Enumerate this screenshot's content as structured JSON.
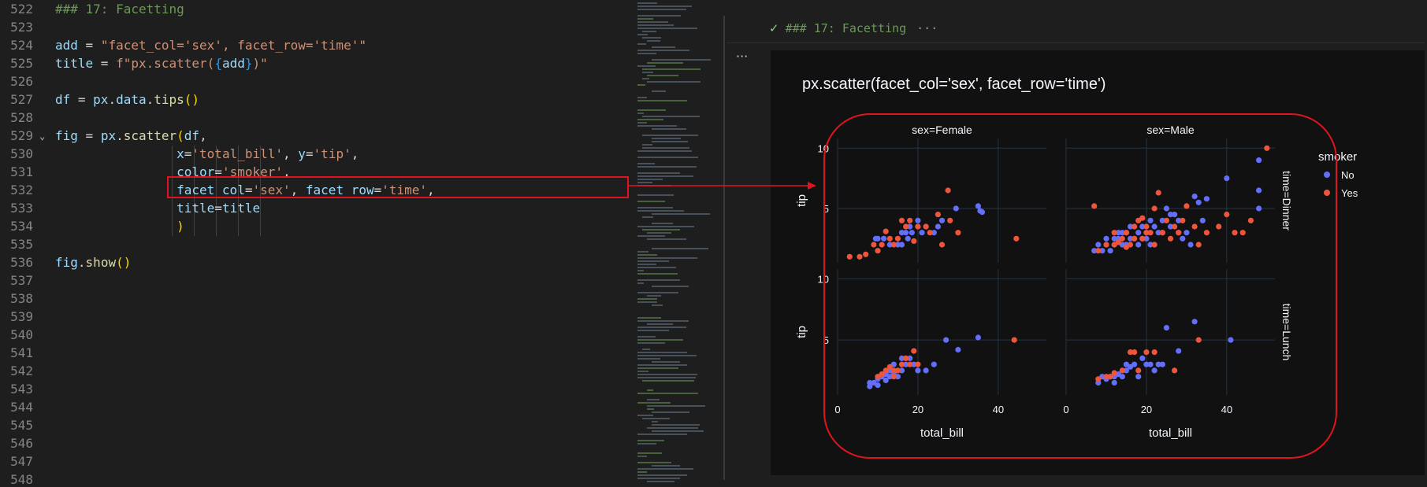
{
  "editor": {
    "lines": [
      {
        "n": "522",
        "tokens": [
          {
            "t": "### 17: Facetting",
            "c": "c-com"
          }
        ]
      },
      {
        "n": "523",
        "tokens": []
      },
      {
        "n": "524",
        "tokens": [
          {
            "t": "add",
            "c": "c-var"
          },
          {
            "t": " = ",
            "c": "c-op"
          },
          {
            "t": "\"facet_col='sex', facet_row='time'\"",
            "c": "c-str"
          }
        ]
      },
      {
        "n": "525",
        "tokens": [
          {
            "t": "title",
            "c": "c-var"
          },
          {
            "t": " = ",
            "c": "c-op"
          },
          {
            "t": "f\"px.scatter(",
            "c": "c-str"
          },
          {
            "t": "{",
            "c": "c-br3"
          },
          {
            "t": "add",
            "c": "c-var"
          },
          {
            "t": "}",
            "c": "c-br3"
          },
          {
            "t": ")\"",
            "c": "c-str"
          }
        ]
      },
      {
        "n": "526",
        "tokens": []
      },
      {
        "n": "527",
        "tokens": [
          {
            "t": "df",
            "c": "c-var"
          },
          {
            "t": " = ",
            "c": "c-op"
          },
          {
            "t": "px",
            "c": "c-var"
          },
          {
            "t": ".",
            "c": "c-op"
          },
          {
            "t": "data",
            "c": "c-var"
          },
          {
            "t": ".",
            "c": "c-op"
          },
          {
            "t": "tips",
            "c": "c-fn"
          },
          {
            "t": "()",
            "c": "c-br"
          }
        ]
      },
      {
        "n": "528",
        "tokens": []
      },
      {
        "n": "529",
        "fold": true,
        "tokens": [
          {
            "t": "fig",
            "c": "c-var"
          },
          {
            "t": " = ",
            "c": "c-op"
          },
          {
            "t": "px",
            "c": "c-var"
          },
          {
            "t": ".",
            "c": "c-op"
          },
          {
            "t": "scatter",
            "c": "c-fn"
          },
          {
            "t": "(",
            "c": "c-br"
          },
          {
            "t": "df",
            "c": "c-var"
          },
          {
            "t": ",",
            "c": "c-op"
          }
        ]
      },
      {
        "n": "530",
        "tokens": [
          {
            "t": "                ",
            "c": "c-op"
          },
          {
            "t": "x",
            "c": "c-var"
          },
          {
            "t": "=",
            "c": "c-op"
          },
          {
            "t": "'total_bill'",
            "c": "c-str"
          },
          {
            "t": ", ",
            "c": "c-op"
          },
          {
            "t": "y",
            "c": "c-var"
          },
          {
            "t": "=",
            "c": "c-op"
          },
          {
            "t": "'tip'",
            "c": "c-str"
          },
          {
            "t": ",",
            "c": "c-op"
          }
        ]
      },
      {
        "n": "531",
        "tokens": [
          {
            "t": "                ",
            "c": "c-op"
          },
          {
            "t": "color",
            "c": "c-var"
          },
          {
            "t": "=",
            "c": "c-op"
          },
          {
            "t": "'smoker'",
            "c": "c-str"
          },
          {
            "t": ",",
            "c": "c-op"
          }
        ]
      },
      {
        "n": "532",
        "tokens": [
          {
            "t": "                ",
            "c": "c-op"
          },
          {
            "t": "facet_col",
            "c": "c-var"
          },
          {
            "t": "=",
            "c": "c-op"
          },
          {
            "t": "'sex'",
            "c": "c-str"
          },
          {
            "t": ", ",
            "c": "c-op"
          },
          {
            "t": "facet_row",
            "c": "c-var"
          },
          {
            "t": "=",
            "c": "c-op"
          },
          {
            "t": "'time'",
            "c": "c-str"
          },
          {
            "t": ",",
            "c": "c-op"
          }
        ]
      },
      {
        "n": "533",
        "tokens": [
          {
            "t": "                ",
            "c": "c-op"
          },
          {
            "t": "title",
            "c": "c-var"
          },
          {
            "t": "=",
            "c": "c-op"
          },
          {
            "t": "title",
            "c": "c-var"
          }
        ]
      },
      {
        "n": "534",
        "tokens": [
          {
            "t": "                ",
            "c": "c-op"
          },
          {
            "t": ")",
            "c": "c-br"
          }
        ]
      },
      {
        "n": "535",
        "tokens": []
      },
      {
        "n": "536",
        "tokens": [
          {
            "t": "fig",
            "c": "c-var"
          },
          {
            "t": ".",
            "c": "c-op"
          },
          {
            "t": "show",
            "c": "c-fn"
          },
          {
            "t": "()",
            "c": "c-br"
          }
        ]
      },
      {
        "n": "537",
        "tokens": []
      },
      {
        "n": "538",
        "tokens": []
      },
      {
        "n": "539",
        "tokens": []
      },
      {
        "n": "540",
        "tokens": []
      },
      {
        "n": "541",
        "tokens": []
      },
      {
        "n": "542",
        "tokens": []
      },
      {
        "n": "543",
        "tokens": []
      },
      {
        "n": "544",
        "tokens": []
      },
      {
        "n": "545",
        "tokens": []
      },
      {
        "n": "546",
        "tokens": []
      },
      {
        "n": "547",
        "tokens": []
      },
      {
        "n": "548",
        "tokens": []
      }
    ]
  },
  "output": {
    "cell_header": "### 17: Facetting",
    "cell_header_more": "···",
    "more_menu": "···"
  },
  "colors": {
    "no": "#636efa",
    "yes": "#ef553b",
    "highlight": "#e0141e"
  },
  "chart_data": {
    "type": "scatter",
    "title": "px.scatter(facet_col='sex', facet_row='time')",
    "xlabel": "total_bill",
    "ylabel": "tip",
    "xlim": [
      0,
      52
    ],
    "ylim": [
      0.5,
      10.8
    ],
    "xticks": [
      0,
      20,
      40
    ],
    "yticks": [
      5,
      10
    ],
    "legend_title": "smoker",
    "legend_placement": "right",
    "col_labels": [
      "sex=Female",
      "sex=Male"
    ],
    "row_labels": [
      "time=Dinner",
      "time=Lunch"
    ],
    "series_names": [
      "No",
      "Yes"
    ],
    "facets": [
      {
        "row": 0,
        "col": 0,
        "No": [
          [
            16,
            3
          ],
          [
            17.5,
            2.5
          ],
          [
            9.5,
            2.5
          ],
          [
            13,
            2
          ],
          [
            11.5,
            2.5
          ],
          [
            20,
            3.5
          ],
          [
            21,
            3
          ],
          [
            25,
            3.5
          ],
          [
            29.5,
            5
          ],
          [
            35,
            5.2
          ],
          [
            35.5,
            4.8
          ],
          [
            36,
            4.7
          ],
          [
            18,
            3.5
          ],
          [
            15,
            2
          ],
          [
            24,
            3
          ],
          [
            22,
            3.5
          ],
          [
            18.5,
            3
          ],
          [
            20,
            4
          ],
          [
            26,
            4
          ],
          [
            17,
            3
          ],
          [
            10,
            2.5
          ],
          [
            16,
            2
          ]
        ],
        "Yes": [
          [
            3,
            1
          ],
          [
            5.5,
            1
          ],
          [
            7,
            1.2
          ],
          [
            9,
            2
          ],
          [
            10,
            1.5
          ],
          [
            14,
            2
          ],
          [
            16,
            4
          ],
          [
            12,
            3.1
          ],
          [
            18,
            4
          ],
          [
            17,
            3.5
          ],
          [
            20,
            3.5
          ],
          [
            22,
            3.5
          ],
          [
            23,
            3
          ],
          [
            25,
            4.5
          ],
          [
            27.5,
            6.5
          ],
          [
            26,
            2
          ],
          [
            30,
            3
          ],
          [
            44.5,
            2.5
          ],
          [
            11,
            2
          ],
          [
            13,
            2.5
          ],
          [
            19,
            2.3
          ],
          [
            15,
            2.5
          ],
          [
            28,
            4
          ]
        ]
      },
      {
        "row": 0,
        "col": 1,
        "No": [
          [
            7,
            1.5
          ],
          [
            9,
            1.5
          ],
          [
            10,
            2
          ],
          [
            12,
            2
          ],
          [
            13,
            2.5
          ],
          [
            14,
            3
          ],
          [
            15,
            2
          ],
          [
            16,
            3.5
          ],
          [
            17,
            2.5
          ],
          [
            18,
            3
          ],
          [
            19,
            3.5
          ],
          [
            20,
            3
          ],
          [
            21,
            4
          ],
          [
            22,
            3.5
          ],
          [
            23,
            3
          ],
          [
            24,
            4
          ],
          [
            25,
            5
          ],
          [
            26,
            3.5
          ],
          [
            27,
            4.5
          ],
          [
            28,
            4
          ],
          [
            30,
            3
          ],
          [
            32,
            6
          ],
          [
            33,
            5.5
          ],
          [
            34,
            4
          ],
          [
            35,
            5.8
          ],
          [
            40,
            7.5
          ],
          [
            48,
            9
          ],
          [
            48,
            6.5
          ],
          [
            48,
            5
          ],
          [
            11,
            1.5
          ],
          [
            12,
            2.5
          ],
          [
            14,
            2
          ],
          [
            16,
            2.5
          ],
          [
            18,
            2
          ],
          [
            20,
            2.5
          ],
          [
            22,
            2
          ],
          [
            29,
            2.5
          ],
          [
            31,
            2
          ],
          [
            8,
            2
          ],
          [
            10,
            2.5
          ],
          [
            13,
            3
          ],
          [
            15,
            3
          ],
          [
            17,
            3.5
          ],
          [
            19,
            2.5
          ],
          [
            21,
            2
          ],
          [
            24,
            3
          ],
          [
            26,
            4.5
          ],
          [
            28,
            3
          ]
        ],
        "Yes": [
          [
            7,
            5.2
          ],
          [
            8,
            1.5
          ],
          [
            10,
            2
          ],
          [
            12,
            2
          ],
          [
            14,
            2.5
          ],
          [
            15,
            3
          ],
          [
            16,
            2
          ],
          [
            17,
            3.5
          ],
          [
            18,
            4
          ],
          [
            19,
            2.5
          ],
          [
            20,
            3.5
          ],
          [
            21,
            3
          ],
          [
            22,
            5
          ],
          [
            23,
            6.3
          ],
          [
            24,
            3
          ],
          [
            25,
            4
          ],
          [
            26,
            2.5
          ],
          [
            28,
            3
          ],
          [
            30,
            5.2
          ],
          [
            32,
            3.5
          ],
          [
            33,
            2
          ],
          [
            35,
            3
          ],
          [
            38,
            3.5
          ],
          [
            40,
            4.5
          ],
          [
            42,
            3
          ],
          [
            44,
            3
          ],
          [
            46,
            4
          ],
          [
            50,
            10
          ],
          [
            12,
            3
          ],
          [
            13,
            2.2
          ],
          [
            15,
            1.8
          ],
          [
            17,
            2.5
          ],
          [
            19,
            4.2
          ],
          [
            20,
            3
          ],
          [
            22,
            2
          ],
          [
            27,
            3.5
          ],
          [
            29,
            4
          ]
        ]
      },
      {
        "row": 1,
        "col": 0,
        "No": [
          [
            8,
            1.2
          ],
          [
            9,
            1.5
          ],
          [
            10,
            1.8
          ],
          [
            11,
            2
          ],
          [
            12,
            2.2
          ],
          [
            13,
            2.5
          ],
          [
            14,
            3
          ],
          [
            15,
            2
          ],
          [
            16,
            2.5
          ],
          [
            17,
            3
          ],
          [
            18,
            3.5
          ],
          [
            19,
            3
          ],
          [
            20,
            2.5
          ],
          [
            22,
            2.5
          ],
          [
            24,
            3
          ],
          [
            27,
            5
          ],
          [
            30,
            4.2
          ],
          [
            35,
            5.2
          ],
          [
            8,
            1.5
          ],
          [
            10,
            1.3
          ],
          [
            12,
            1.7
          ],
          [
            14,
            2.2
          ],
          [
            16,
            3.5
          ],
          [
            13,
            2
          ]
        ],
        "Yes": [
          [
            10,
            2
          ],
          [
            12,
            2.5
          ],
          [
            13,
            2.8
          ],
          [
            14,
            2
          ],
          [
            15,
            2.5
          ],
          [
            16,
            3
          ],
          [
            17,
            3.5
          ],
          [
            18,
            3
          ],
          [
            19,
            4.1
          ],
          [
            20,
            3
          ],
          [
            44,
            5
          ],
          [
            11,
            2.2
          ],
          [
            14,
            2.5
          ]
        ]
      },
      {
        "row": 1,
        "col": 1,
        "No": [
          [
            8,
            1.5
          ],
          [
            9,
            2
          ],
          [
            10,
            1.8
          ],
          [
            11,
            2
          ],
          [
            12,
            2
          ],
          [
            13,
            2.2
          ],
          [
            14,
            2
          ],
          [
            15,
            2.5
          ],
          [
            16,
            2.8
          ],
          [
            17,
            3
          ],
          [
            18,
            2
          ],
          [
            19,
            3.5
          ],
          [
            20,
            3
          ],
          [
            21,
            3
          ],
          [
            22,
            2.5
          ],
          [
            23,
            3
          ],
          [
            25,
            6
          ],
          [
            28,
            4.1
          ],
          [
            32,
            6.5
          ],
          [
            41,
            5
          ],
          [
            24,
            3
          ],
          [
            12,
            1.5
          ],
          [
            15,
            3
          ]
        ],
        "Yes": [
          [
            8,
            1.8
          ],
          [
            10,
            2
          ],
          [
            12,
            2.3
          ],
          [
            14,
            2.5
          ],
          [
            16,
            4
          ],
          [
            17,
            4
          ],
          [
            18,
            2.5
          ],
          [
            20,
            4
          ],
          [
            22,
            4
          ],
          [
            27,
            2.5
          ],
          [
            33,
            5
          ],
          [
            11,
            2
          ]
        ]
      }
    ]
  }
}
